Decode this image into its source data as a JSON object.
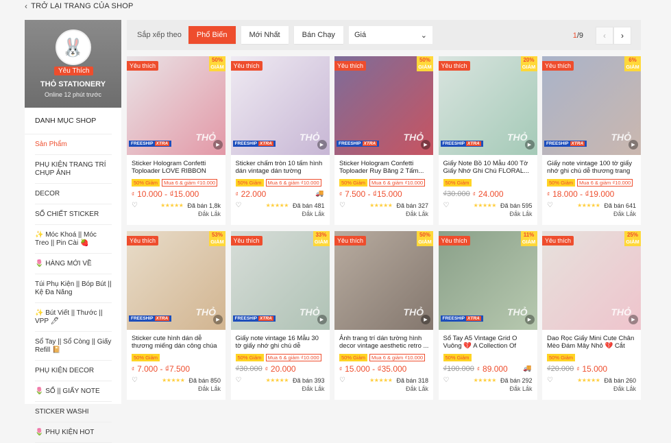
{
  "back_link": "TRỞ LẠI TRANG CỦA SHOP",
  "shop": {
    "name": "THỎ STATIONERY",
    "badge": "Yêu Thích",
    "online": "Online 12 phút trước"
  },
  "categories": {
    "title": "DANH MỤC SHOP",
    "items": [
      {
        "label": "Sản Phẩm",
        "active": true
      },
      {
        "label": "PHỤ KIỆN TRANG TRÍ CHỤP ẢNH"
      },
      {
        "label": "DECOR"
      },
      {
        "label": "SỔ CHIẾT STICKER"
      },
      {
        "label": "✨ Móc Khoá || Móc Treo || Pin Cài 🍓"
      },
      {
        "label": "🌷 HÀNG MỚI VỀ"
      },
      {
        "label": "Túi Phụ Kiện || Bóp Bút || Kệ Đa Năng"
      },
      {
        "label": "✨ Bút Viết || Thước || VPP 🖊"
      },
      {
        "label": "Sổ Tay || Sổ Còng || Giấy Refill 📔"
      },
      {
        "label": "PHỤ KIỆN DECOR"
      },
      {
        "label": "🌷 SỔ || GIẤY NOTE"
      },
      {
        "label": "STICKER WASHI"
      },
      {
        "label": "🌷 PHỤ KIỆN HOT"
      }
    ]
  },
  "sortbar": {
    "label": "Sắp xếp theo",
    "options": [
      "Phổ Biến",
      "Mới Nhất",
      "Bán Chạy"
    ],
    "price_select": "Giá",
    "page_current": "1",
    "page_total": "/9"
  },
  "common": {
    "fav": "Yêu thích",
    "discount_suffix": "GIẢM",
    "freeship": "FREESHIP",
    "xtra": "XTRA",
    "watermark": "THỎ",
    "location": "Đắk Lắk"
  },
  "products": [
    {
      "title": "Sticker Hologram Confetti Toploader LOVE RIBBON Hìn...",
      "discount": "50%",
      "tag1": "50% Giảm",
      "tag2": "Mua 6 & giảm ₫10.000",
      "price": "10.000 - ₫15.000",
      "old": "",
      "sold": "Đã bán 1,8k",
      "bg": "#e9e3e6",
      "accent": "#e07a8d",
      "truck": false,
      "freeship": true
    },
    {
      "title": "Sticker chấm tròn 10 tấm hình dán vintage dán tường postca...",
      "discount": "",
      "tag1": "50% Giảm",
      "tag2": "Mua 6 & giảm ₫10.000",
      "price": "22.000",
      "old": "",
      "sold": "Đã bán 481",
      "bg": "#efeaf2",
      "accent": "#b7a2c9",
      "truck": true,
      "freeship": true
    },
    {
      "title": "Sticker Hologram Confetti Toploader Ruy Băng 2 Tấm...",
      "discount": "50%",
      "tag1": "50% Giảm",
      "tag2": "Mua 6 & giảm ₫10.000",
      "price": "7.500 - ₫15.000",
      "old": "",
      "sold": "Đã bán 327",
      "bg": "#7d6d9a",
      "accent": "#e64a4a",
      "truck": false,
      "freeship": true
    },
    {
      "title": "Giấy Note Bồ 10 Mẫu 400 Tờ Giấy Nhớ Ghi Chú FLORAL...",
      "discount": "20%",
      "tag1": "50% Giảm",
      "tag2": "",
      "price": "24.000",
      "old": "₫30.000",
      "sold": "Đã bán 595",
      "bg": "#d9e4df",
      "accent": "#8fbfa7",
      "truck": false,
      "freeship": true
    },
    {
      "title": "Giấy note vintage 100 tờ giấy nhớ ghi chú dễ thương trang t...",
      "discount": "6%",
      "tag1": "50% Giảm",
      "tag2": "Mua 6 & giảm ₫10.000",
      "price": "18.000 - ₫19.000",
      "old": "",
      "sold": "Đã bán 641",
      "bg": "#a9b3c9",
      "accent": "#d8b9a4",
      "truck": false,
      "freeship": true
    },
    {
      "title": "Sticker cute hình dán dễ thương miếng dán công chúa trang trí...",
      "discount": "53%",
      "tag1": "50% Giảm",
      "tag2": "",
      "price": "7.000 - ₫7.500",
      "old": "",
      "sold": "Đã bán 850",
      "bg": "#e8dcc9",
      "accent": "#c9a57a",
      "truck": false,
      "freeship": true
    },
    {
      "title": "Giấy note vintage 16 Mẫu 30 tờ giấy nhớ ghi chú dễ thương...",
      "discount": "33%",
      "tag1": "50% Giảm",
      "tag2": "Mua 6 & giảm ₫10.000",
      "price": "20.000",
      "old": "₫30.000",
      "sold": "Đã bán 393",
      "bg": "#d7ddd8",
      "accent": "#9fb7a7",
      "truck": false,
      "freeship": true
    },
    {
      "title": "Ảnh trang trí dán tường hình decor vintage aesthetic retro ...",
      "discount": "50%",
      "tag1": "50% Giảm",
      "tag2": "Mua 6 & giảm ₫10.000",
      "price": "15.000 - ₫35.000",
      "old": "",
      "sold": "Đã bán 318",
      "bg": "#b8aca0",
      "accent": "#6f625a",
      "truck": false,
      "freeship": false
    },
    {
      "title": "Sổ Tay A5 Vintage Grid O Vuông 💔 A Collection Of Old...",
      "discount": "11%",
      "tag1": "50% Giảm",
      "tag2": "",
      "price": "89.000",
      "old": "₫100.000",
      "sold": "Đã bán 292",
      "bg": "#8aa089",
      "accent": "#c9d9bf",
      "truck": true,
      "freeship": true
    },
    {
      "title": "Dao Rọc Giấy Mini Cute Chân Mèo Đám Mây Nhỏ 💔 Cắt Gi...",
      "discount": "25%",
      "tag1": "50% Giảm",
      "tag2": "",
      "price": "15.000",
      "old": "₫20.000",
      "sold": "Đã bán 260",
      "bg": "#e6e1dc",
      "accent": "#f2b8c6",
      "truck": false,
      "freeship": false
    }
  ],
  "colors": {
    "brand": "#ee4d2d",
    "rating": "#ffce3d",
    "freeship_blue": "#1d4ebb"
  }
}
